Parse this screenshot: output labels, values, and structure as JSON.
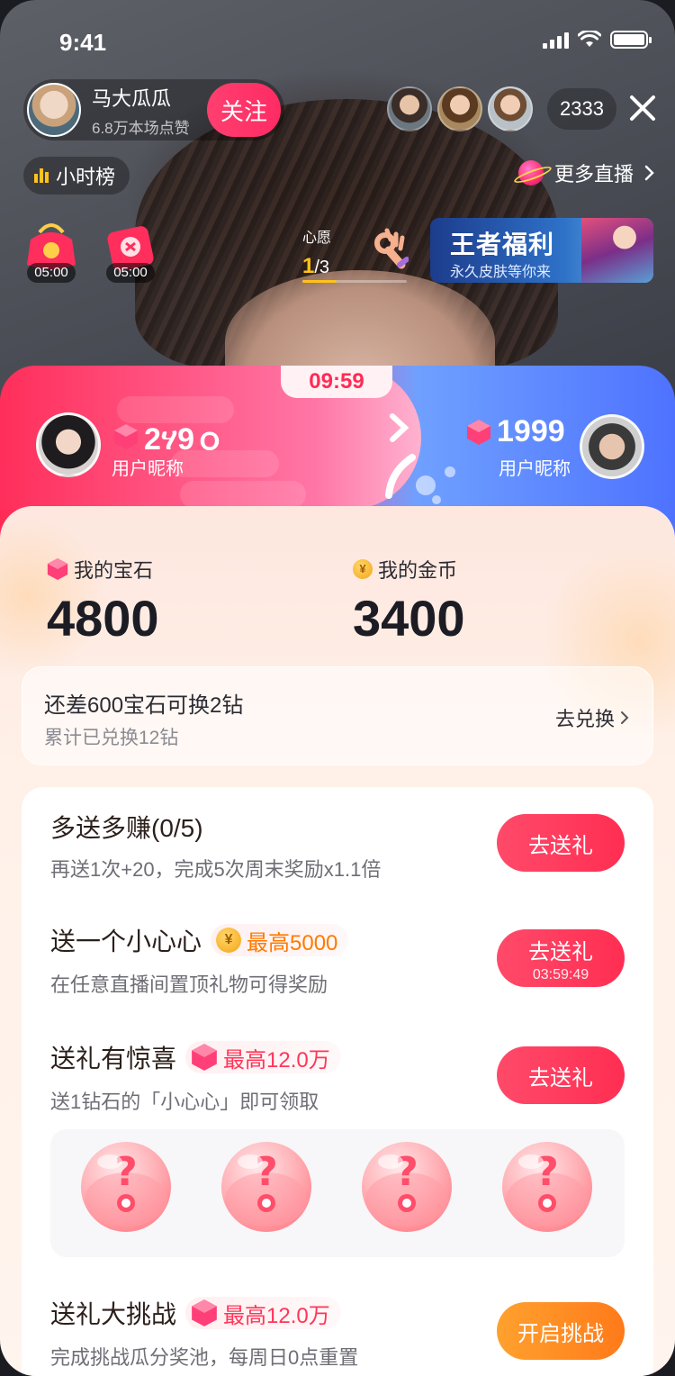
{
  "status_bar": {
    "time": "9:41"
  },
  "host": {
    "name": "马大瓜瓜",
    "likes": "6.8万本场点赞",
    "follow_label": "关注"
  },
  "viewers": {
    "count": "2333"
  },
  "hourly_rank": {
    "label": "小时榜"
  },
  "more_live": {
    "label": "更多直播"
  },
  "red_packets": [
    {
      "timer": "05:00"
    },
    {
      "timer": "05:00"
    }
  ],
  "wish": {
    "label": "心愿",
    "current": "1",
    "total": "/3",
    "progress": 0.33
  },
  "banner": {
    "title": "王者福利",
    "subtitle": "永久皮肤等你来"
  },
  "pk": {
    "timer": "09:59",
    "left": {
      "score": "2ሃ9ｏ",
      "name": "用户昵称"
    },
    "right": {
      "score": "1999",
      "name": "用户昵称"
    }
  },
  "wallet": {
    "gems_label": "我的宝石",
    "gems_value": "4800",
    "coins_label": "我的金币",
    "coins_value": "3400"
  },
  "exchange": {
    "title": "还差600宝石可换2钻",
    "subtitle": "累计已兑换12钻",
    "action": "去兑换"
  },
  "tasks": [
    {
      "title": "多送多赚(0/5)",
      "subtitle": "再送1次+20，完成5次周末奖励x1.1倍",
      "button": "去送礼"
    },
    {
      "title": "送一个小心心",
      "reward": "最高5000",
      "subtitle": "在任意直播间置顶礼物可得奖励",
      "button": "去送礼",
      "countdown": "03:59:49"
    },
    {
      "title": "送礼有惊喜",
      "reward": "最高12.0万",
      "subtitle": "送1钻石的「小心心」即可领取",
      "button": "去送礼"
    },
    {
      "title": "送礼大挑战",
      "reward": "最高12.0万",
      "subtitle": "完成挑战瓜分奖池，每周日0点重置",
      "button": "开启挑战"
    }
  ],
  "colors": {
    "accent_pink": "#ff2e52",
    "accent_orange": "#ff7a1a",
    "pk_blue": "#4e72ff",
    "gold": "#ffc21a"
  }
}
